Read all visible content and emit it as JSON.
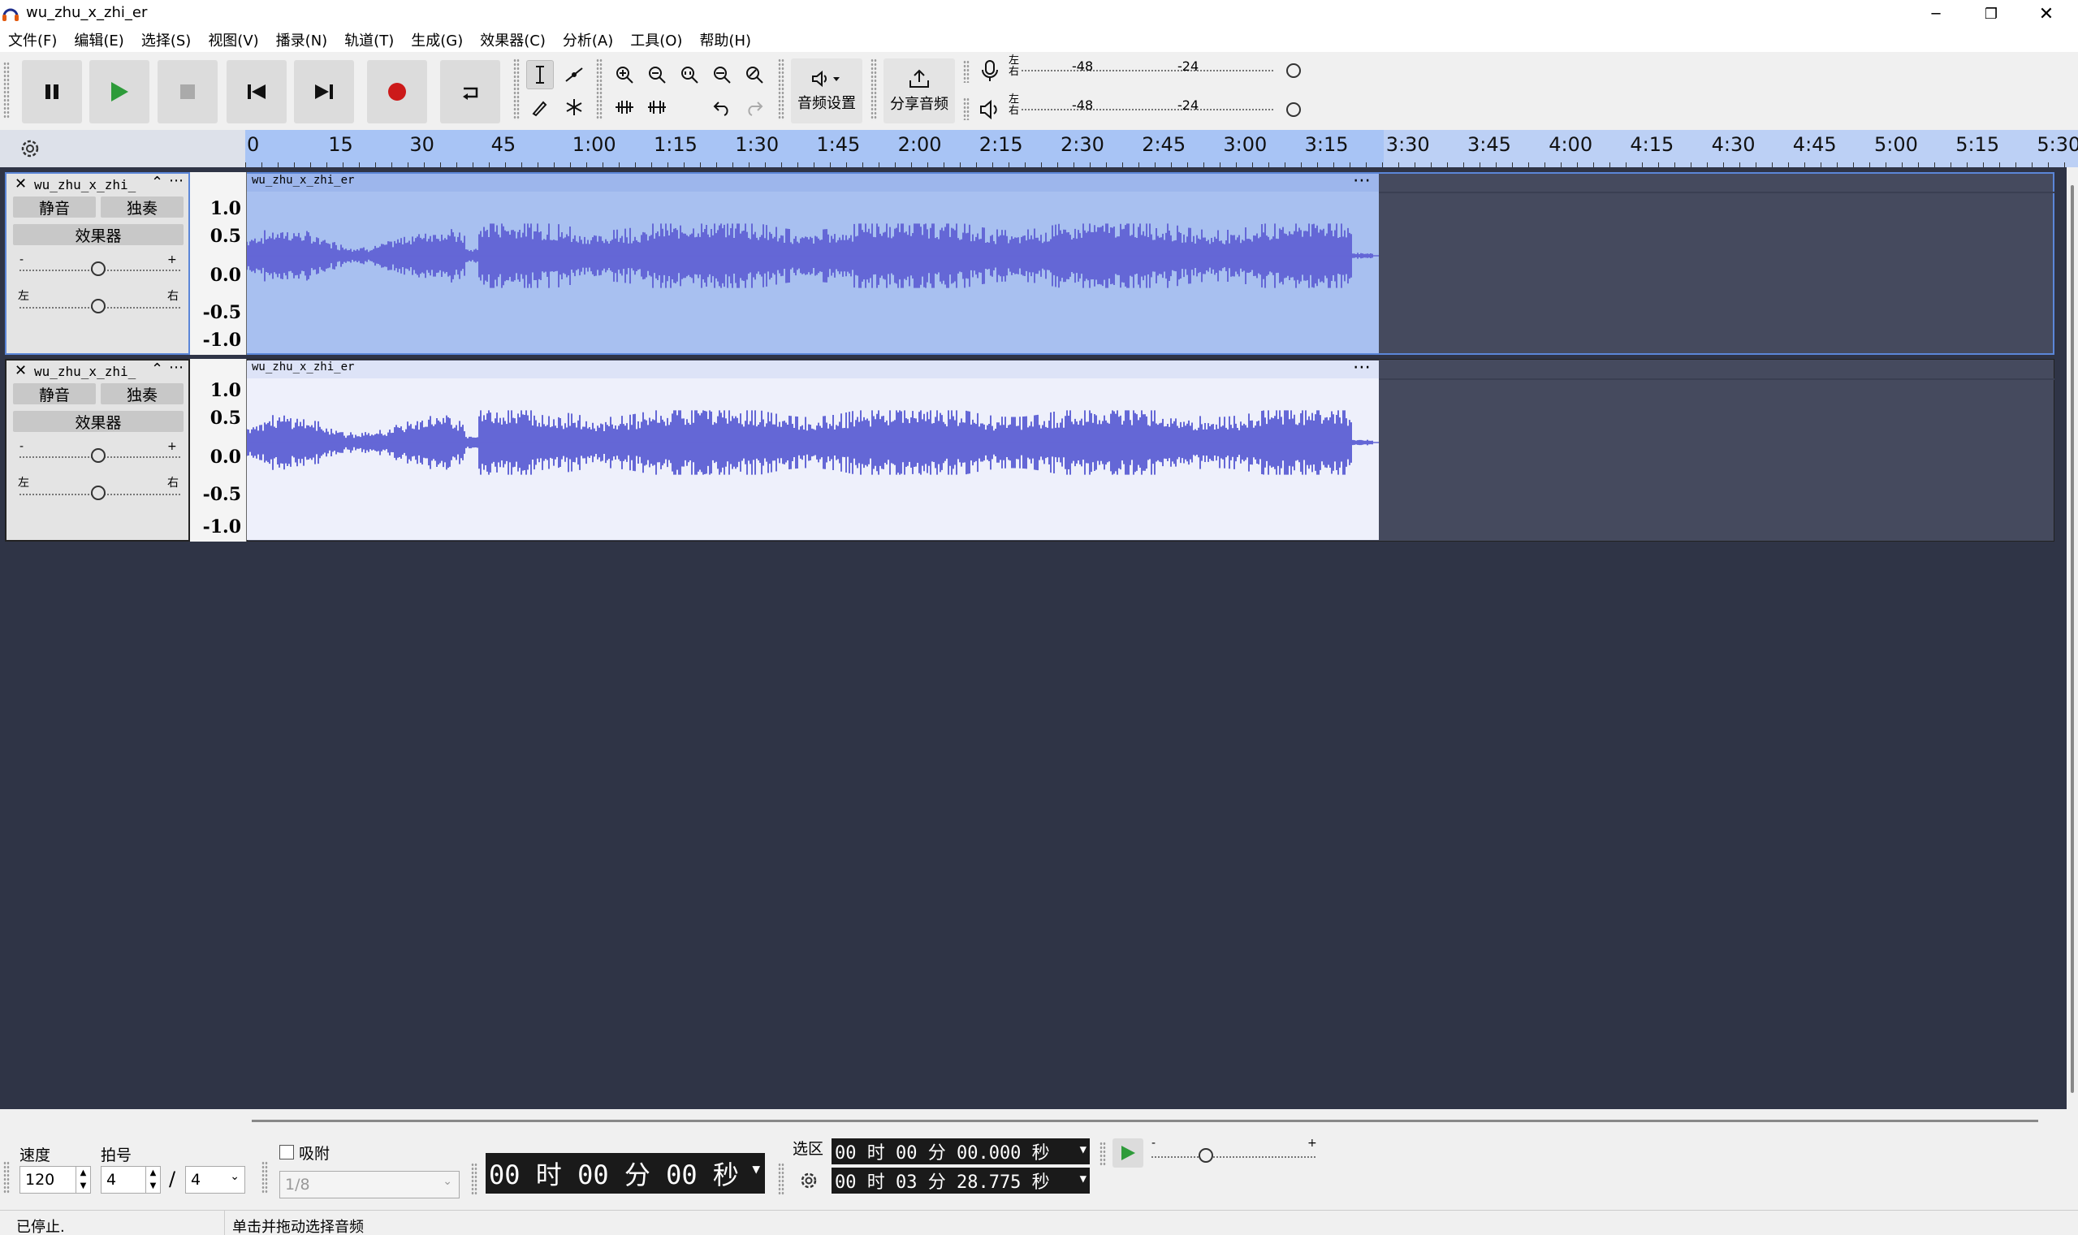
{
  "window": {
    "title": "wu_zhu_x_zhi_er",
    "minimize_glyph": "─",
    "restore_glyph": "❐",
    "close_glyph": "✕"
  },
  "menu": [
    "文件(F)",
    "编辑(E)",
    "选择(S)",
    "视图(V)",
    "播录(N)",
    "轨道(T)",
    "生成(G)",
    "效果器(C)",
    "分析(A)",
    "工具(O)",
    "帮助(H)"
  ],
  "toolbar": {
    "audio_setup_label": "音频设置",
    "share_audio_label": "分享音频",
    "meter_labels": [
      "-48",
      "-24"
    ],
    "meter_lr": [
      "左",
      "右"
    ]
  },
  "timeline": {
    "ticks": [
      "0",
      "15",
      "30",
      "45",
      "1:00",
      "1:15",
      "1:30",
      "1:45",
      "2:00",
      "2:15",
      "2:30",
      "2:45",
      "3:00",
      "3:15",
      "3:30",
      "3:45",
      "4:00",
      "4:15",
      "4:30",
      "4:45",
      "5:00",
      "5:15",
      "5:30"
    ]
  },
  "tracks": [
    {
      "name": "wu_zhu_x_zhi_",
      "clip_name": "wu_zhu_x_zhi_er",
      "mute_label": "静音",
      "solo_label": "独奏",
      "effects_label": "效果器",
      "gain_minus": "-",
      "gain_plus": "+",
      "pan_left": "左",
      "pan_right": "右",
      "scale": [
        "1.0",
        "0.5",
        "0.0",
        "-0.5",
        "-1.0"
      ],
      "selected": true
    },
    {
      "name": "wu_zhu_x_zhi_",
      "clip_name": "wu_zhu_x_zhi_er",
      "mute_label": "静音",
      "solo_label": "独奏",
      "effects_label": "效果器",
      "gain_minus": "-",
      "gain_plus": "+",
      "pan_left": "左",
      "pan_right": "右",
      "scale": [
        "1.0",
        "0.5",
        "0.0",
        "-0.5",
        "-1.0"
      ],
      "selected": false
    }
  ],
  "bottom": {
    "tempo_label": "速度",
    "tempo_value": "120",
    "time_sig_label": "拍号",
    "time_sig_top": "4",
    "time_sig_sep": "/",
    "time_sig_bottom": "4",
    "snap_label": "吸附",
    "snap_value": "1/8",
    "position_time": "00 时 00 分 00 秒",
    "selection_label": "选区",
    "selection_start": "00 时 00 分 00.000 秒",
    "selection_end": "00 时 03 分 28.775 秒",
    "playback_minus": "-",
    "playback_plus": "+"
  },
  "status": {
    "state": "已停止.",
    "hint": "单击并拖动选择音频"
  },
  "colors": {
    "waveform": "#6467d6",
    "track_bg": "#2f3446",
    "record": "#cc1a1a",
    "play": "#2e9b3a"
  }
}
